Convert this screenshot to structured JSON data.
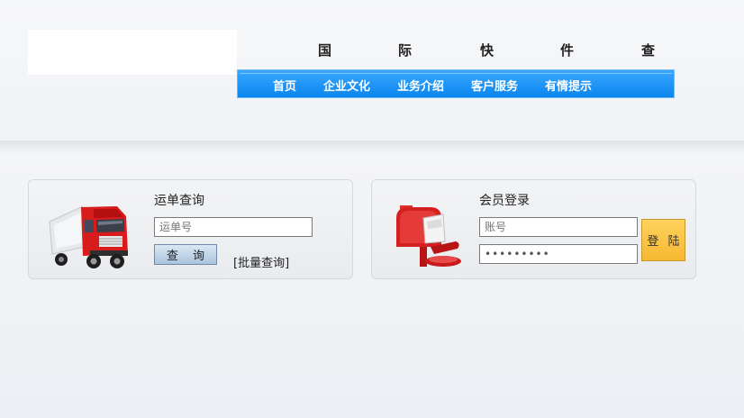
{
  "header": {
    "title_chars": [
      "国",
      "际",
      "快",
      "件",
      "查"
    ],
    "nav": [
      "首页",
      "企业文化",
      "业务介绍",
      "客户服务",
      "有情提示"
    ]
  },
  "tracking": {
    "title": "运单查询",
    "input_placeholder": "运单号",
    "query_button": "查 询",
    "batch_link": "[批量查询]",
    "icon": "truck-icon"
  },
  "member": {
    "title": "会员登录",
    "account_placeholder": "账号",
    "password_value": "•••••••••",
    "login_button": "登 陆",
    "icon": "mailbox-icon"
  },
  "colors": {
    "nav_blue": "#1190f5",
    "login_orange": "#f8c040",
    "truck_red": "#d81c1c",
    "mailbox_red": "#d42020"
  }
}
